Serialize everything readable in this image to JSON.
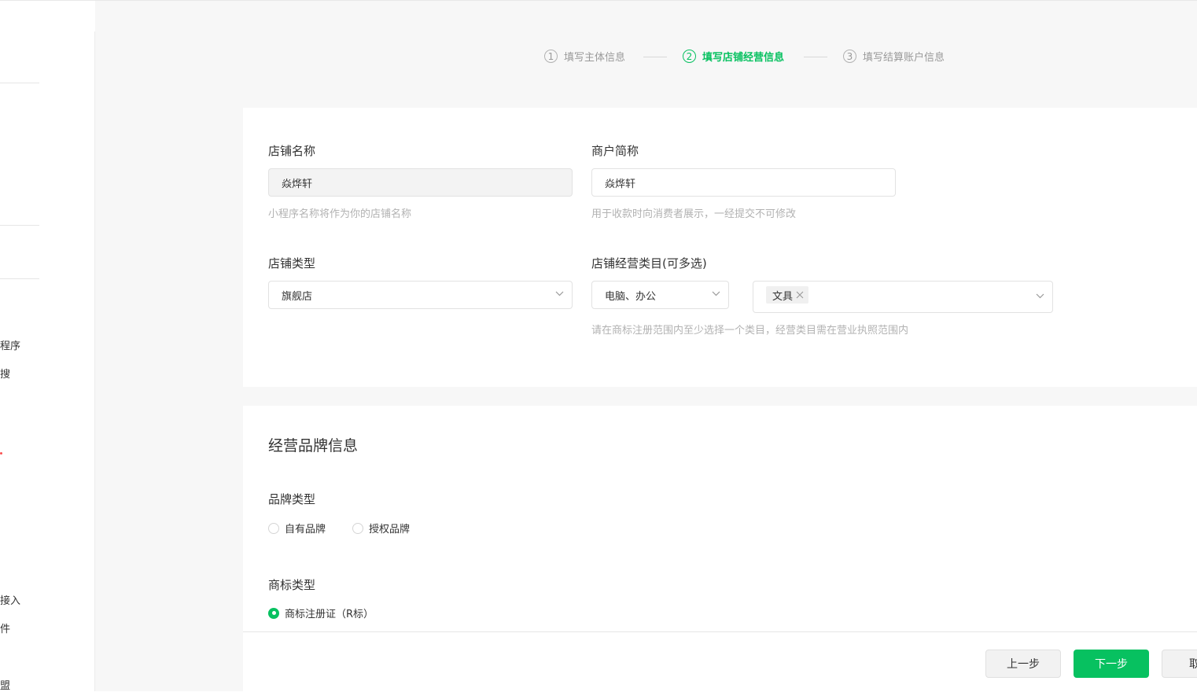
{
  "sidebar": {
    "items": [
      "程序",
      "搜",
      "接入",
      "件",
      "盟"
    ]
  },
  "steps": [
    {
      "num": "1",
      "label": "填写主体信息"
    },
    {
      "num": "2",
      "label": "填写店铺经营信息"
    },
    {
      "num": "3",
      "label": "填写结算账户信息"
    }
  ],
  "store_info": {
    "store_name_label": "店铺名称",
    "store_name_value": "焱烨轩",
    "store_name_hint": "小程序名称将作为你的店铺名称",
    "merchant_short_label": "商户简称",
    "merchant_short_value": "焱烨轩",
    "merchant_short_hint": "用于收款时向消费者展示，一经提交不可修改",
    "store_type_label": "店铺类型",
    "store_type_value": "旗舰店",
    "category_label": "店铺经营类目(可多选)",
    "category_primary": "电脑、办公",
    "category_tag": "文具",
    "category_hint": "请在商标注册范围内至少选择一个类目，经营类目需在营业执照范围内"
  },
  "brand_info": {
    "title": "经营品牌信息",
    "brand_type_label": "品牌类型",
    "brand_type_options": [
      "自有品牌",
      "授权品牌"
    ],
    "trademark_type_label": "商标类型",
    "trademark_option": "商标注册证（R标）"
  },
  "footer": {
    "prev_label": "上一步",
    "next_label": "下一步",
    "cancel_label": "取"
  },
  "colors": {
    "primary": "#07c160",
    "hint": "#b2b2b2",
    "background": "#f7f7f7"
  }
}
